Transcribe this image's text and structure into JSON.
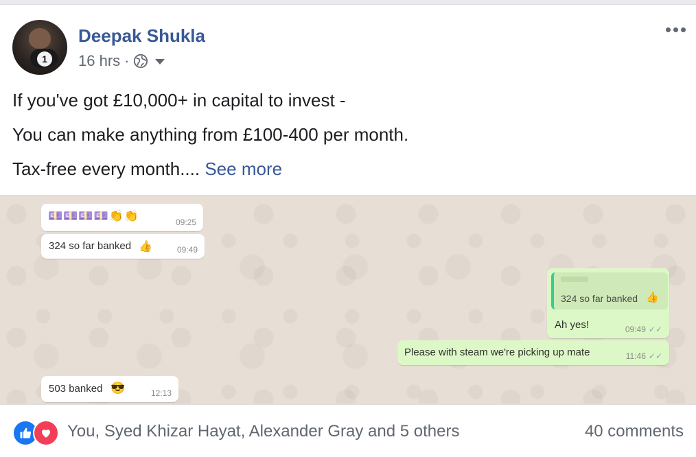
{
  "post": {
    "author": "Deepak Shukla",
    "time": "16 hrs",
    "separator": "·",
    "audience_icon": "globe-icon",
    "lines": [
      "If you've got £10,000+ in capital to invest -",
      "You can make anything from £100-400 per month.",
      "Tax-free every month...."
    ],
    "see_more": "See more",
    "avatar_mic_label": "1"
  },
  "chat": {
    "messages": [
      {
        "side": "in",
        "text": "",
        "emoji": "💷💷💷💷👏👏",
        "time": "09:25"
      },
      {
        "side": "in",
        "text": "324 so far banked",
        "emoji": "👍",
        "time": "09:49"
      },
      {
        "side": "out",
        "quoted": "324 so far banked",
        "quoted_emoji": "👍",
        "text": "Ah yes!",
        "time": "09:49",
        "ticks": "✓✓"
      },
      {
        "side": "out",
        "text": "Please with steam we're picking up mate",
        "time": "11:46",
        "ticks": "✓✓"
      },
      {
        "side": "in",
        "text": "503 banked",
        "emoji": "😎",
        "time": "12:13"
      }
    ]
  },
  "footer": {
    "reaction_icons": [
      "like-icon",
      "love-icon"
    ],
    "reacted_by": "You, Syed Khizar Hayat, Alexander Gray and 5 others",
    "comments": "40 comments"
  },
  "colors": {
    "link": "#385898",
    "meta": "#606770",
    "chat_bg": "#e7dfd5",
    "bubble_in": "#ffffff",
    "bubble_out": "#dcf8c6",
    "like": "#1877f2",
    "love": "#f33e58"
  }
}
